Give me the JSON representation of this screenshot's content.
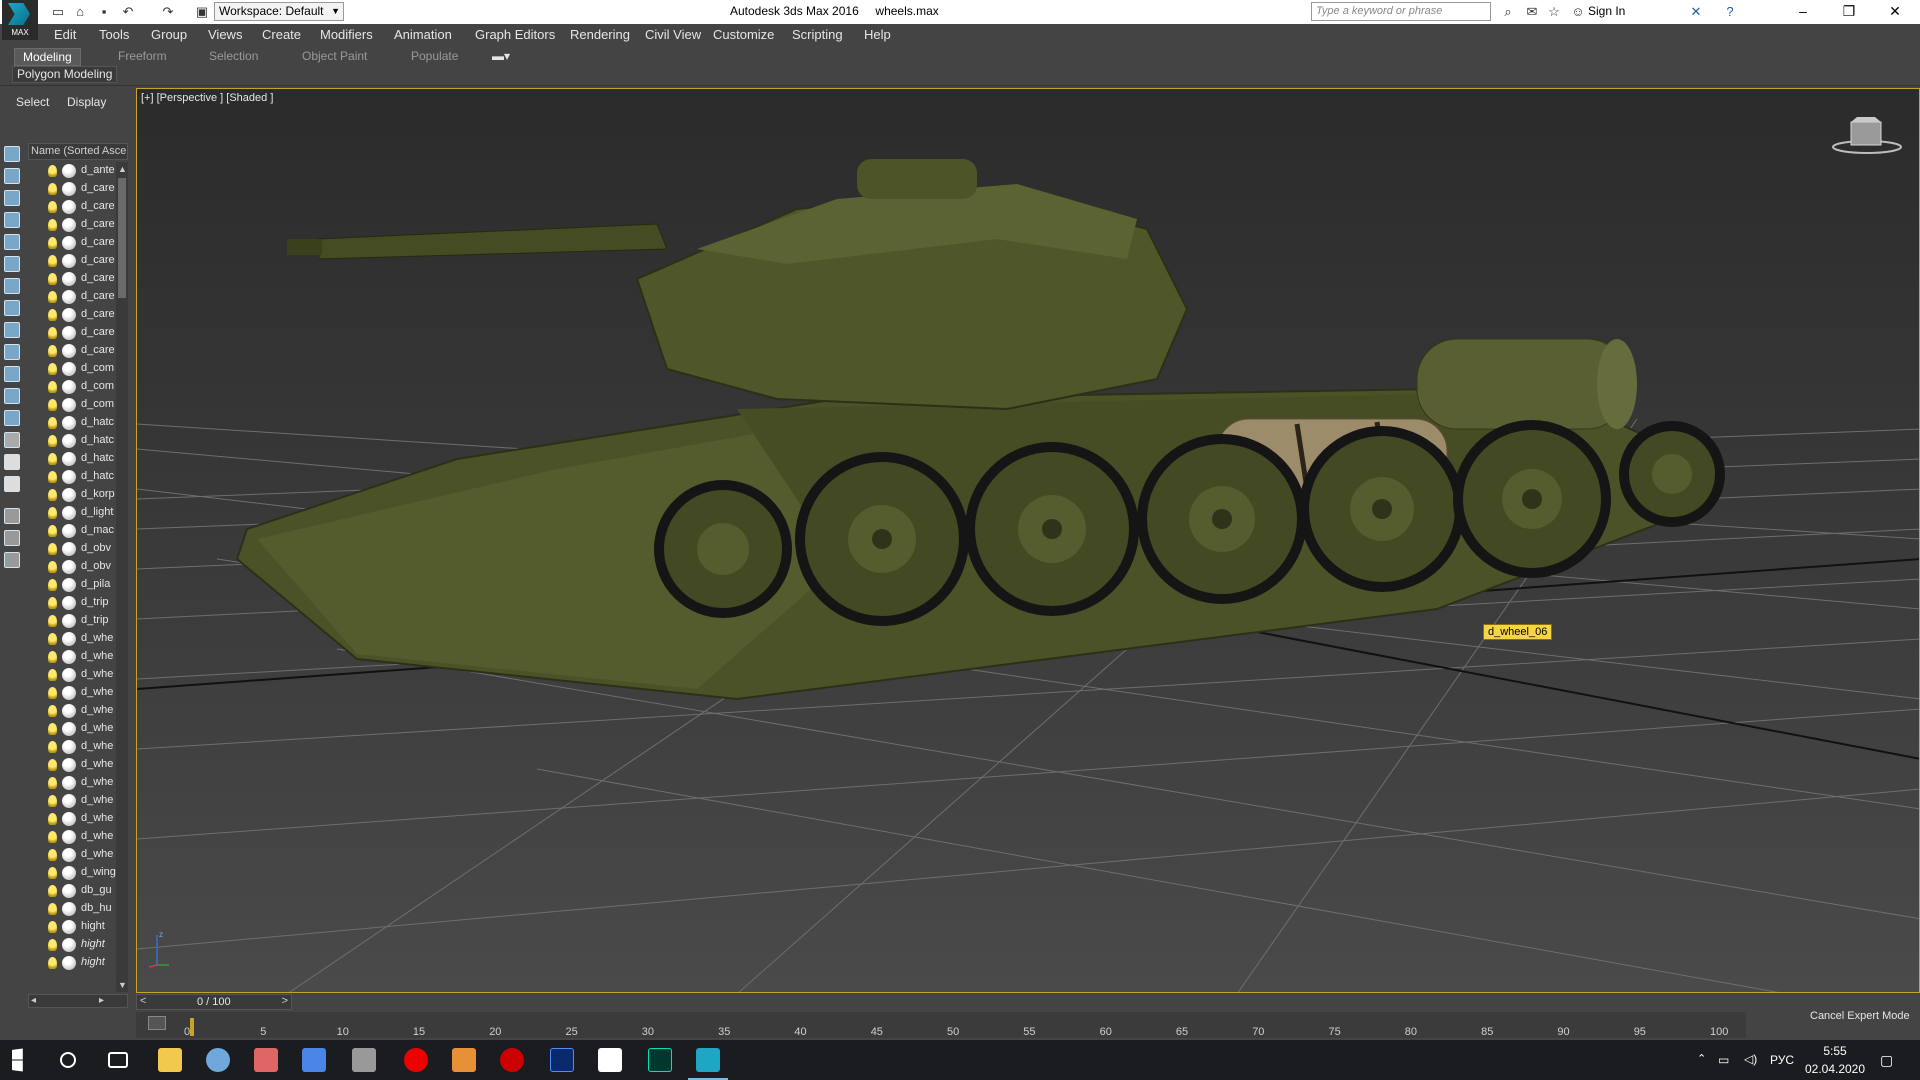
{
  "titlebar": {
    "logo_text": "MAX",
    "workspace": "Workspace: Default",
    "title": "Autodesk 3ds Max 2016     wheels.max",
    "search_placeholder": "Type a keyword or phrase",
    "sign_in": "Sign In"
  },
  "menu": [
    "Edit",
    "Tools",
    "Group",
    "Views",
    "Create",
    "Modifiers",
    "Animation",
    "Graph Editors",
    "Rendering",
    "Civil View",
    "Customize",
    "Scripting",
    "Help"
  ],
  "ribbon": {
    "tabs": [
      "Modeling",
      "Freeform",
      "Selection",
      "Object Paint",
      "Populate"
    ],
    "active_tab": "Modeling",
    "panel_label": "Polygon Modeling"
  },
  "scene_explorer": {
    "tabs": [
      "Select",
      "Display"
    ],
    "header": "Name (Sorted Ascending)",
    "items": [
      "d_ante",
      "d_care",
      "d_care",
      "d_care",
      "d_care",
      "d_care",
      "d_care",
      "d_care",
      "d_care",
      "d_care",
      "d_care",
      "d_com",
      "d_com",
      "d_com",
      "d_hatc",
      "d_hatc",
      "d_hatc",
      "d_hatc",
      "d_korp",
      "d_light",
      "d_mac",
      "d_obv",
      "d_obv",
      "d_pila",
      "d_trip",
      "d_trip",
      "d_whe",
      "d_whe",
      "d_whe",
      "d_whe",
      "d_whe",
      "d_whe",
      "d_whe",
      "d_whe",
      "d_whe",
      "d_whe",
      "d_whe",
      "d_whe",
      "d_whe",
      "d_wing",
      "db_gu",
      "db_hu",
      "hight",
      "hight",
      "hight"
    ]
  },
  "viewport": {
    "label": "[+] [Perspective ] [Shaded ]",
    "tooltip": "d_wheel_06",
    "axis_label": "z"
  },
  "timeline": {
    "frame": "0 / 100",
    "ticks": [
      "0",
      "5",
      "10",
      "15",
      "20",
      "25",
      "30",
      "35",
      "40",
      "45",
      "50",
      "55",
      "60",
      "65",
      "70",
      "75",
      "80",
      "85",
      "90",
      "95",
      "100"
    ],
    "cancel_expert": "Cancel Expert Mode"
  },
  "taskbar": {
    "language": "РУС",
    "time": "5:55",
    "date": "02.04.2020",
    "app_icons": [
      "windows-start",
      "search",
      "task-view",
      "file-explorer",
      "paint-app",
      "paint-brush",
      "network-app",
      "game-app",
      "red-record",
      "filezilla",
      "s-app",
      "photoshop",
      "p-app",
      "audition",
      "3dsmax"
    ]
  },
  "colors": {
    "accent_yellow": "#f5d547",
    "viewport_border": "#c9a227",
    "tank_green": "#4b5228",
    "grid": "#7b7b7b"
  }
}
